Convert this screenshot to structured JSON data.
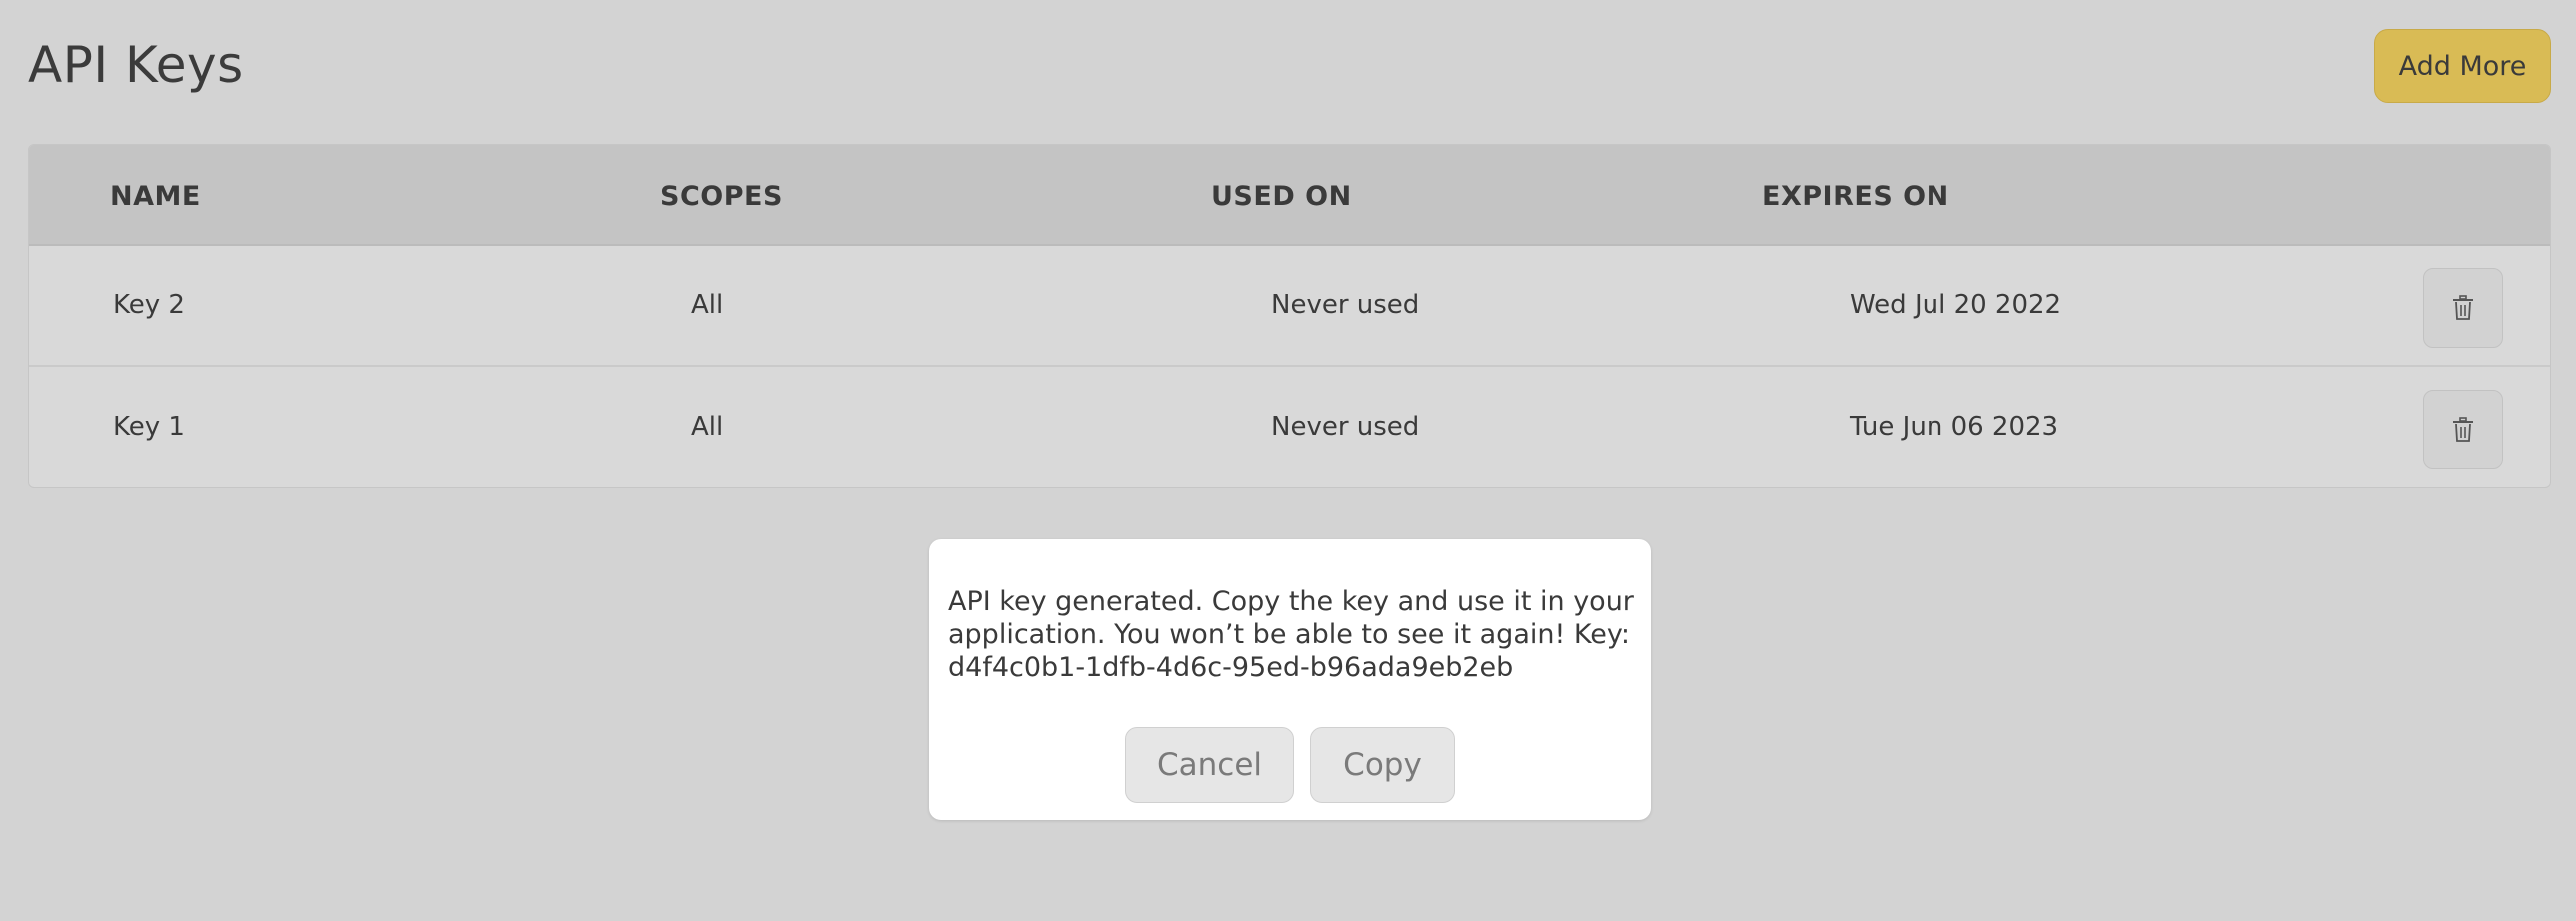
{
  "header": {
    "title": "API Keys",
    "add_button_label": "Add More"
  },
  "table": {
    "columns": [
      "NAME",
      "SCOPES",
      "USED ON",
      "EXPIRES ON"
    ],
    "rows": [
      {
        "name": "Key 2",
        "scopes": "All",
        "used_on": "Never used",
        "expires_on": "Wed Jul 20 2022",
        "delete_icon": "trash-icon"
      },
      {
        "name": "Key 1",
        "scopes": "All",
        "used_on": "Never used",
        "expires_on": "Tue Jun 06 2023",
        "delete_icon": "trash-icon"
      }
    ]
  },
  "dialog": {
    "message": "API key generated. Copy the key and use it in your application. You won’t be able to see it again! Key:",
    "key": "d4f4c0b1-1dfb-4d6c-95ed-b96ada9eb2eb",
    "cancel_label": "Cancel",
    "copy_label": "Copy"
  },
  "colors": {
    "background": "#d3d3d3",
    "accent": "#d9bb55",
    "table_header": "#c4c4c4",
    "dialog_bg": "#ffffff"
  }
}
